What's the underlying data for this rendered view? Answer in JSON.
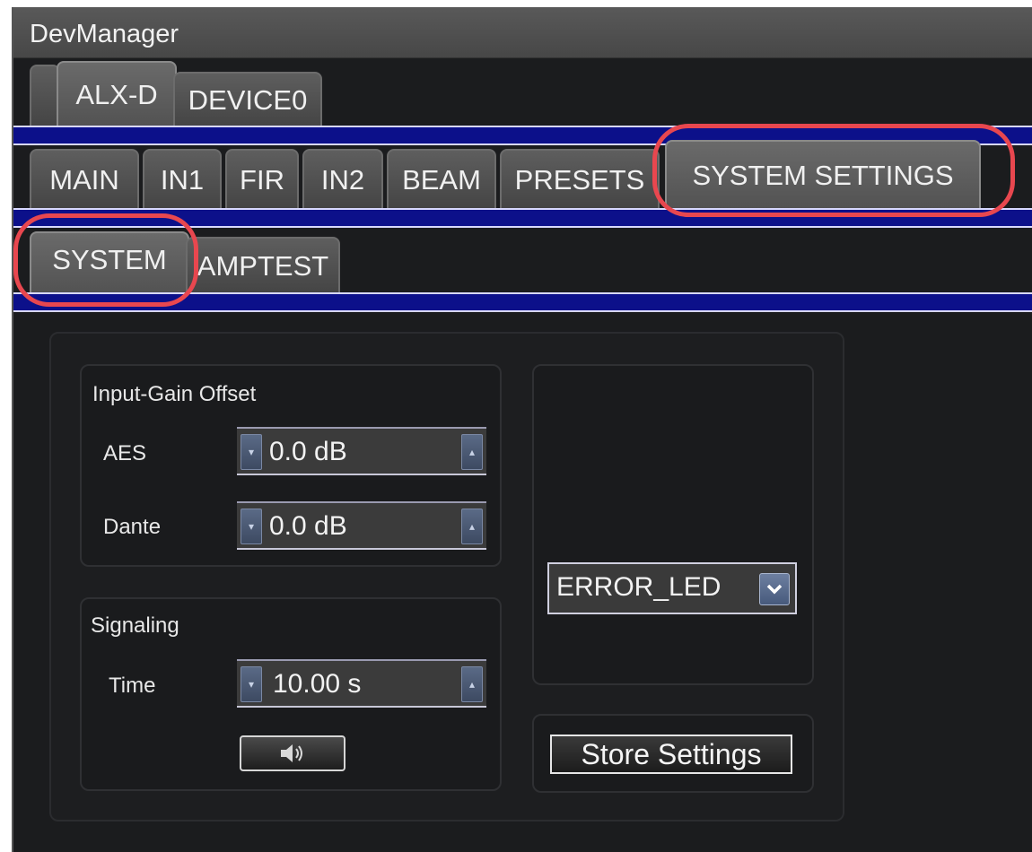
{
  "window": {
    "title": "DevManager"
  },
  "device_tabs": [
    {
      "label": ""
    },
    {
      "label": "ALX-D"
    },
    {
      "label": "DEVICE0"
    }
  ],
  "main_tabs": [
    {
      "label": "MAIN"
    },
    {
      "label": "IN1"
    },
    {
      "label": "FIR"
    },
    {
      "label": "IN2"
    },
    {
      "label": "BEAM"
    },
    {
      "label": "PRESETS"
    },
    {
      "label": "SYSTEM SETTINGS"
    }
  ],
  "sub_tabs": [
    {
      "label": "SYSTEM"
    },
    {
      "label": "AMPTEST"
    }
  ],
  "input_gain_offset": {
    "title": "Input-Gain Offset",
    "aes_label": "AES",
    "aes_value": "0.0 dB",
    "dante_label": "Dante",
    "dante_value": "0.0 dB"
  },
  "signaling": {
    "title": "Signaling",
    "time_label": "Time",
    "time_value": "10.00 s"
  },
  "led_select": {
    "selected": "ERROR_LED"
  },
  "store_button": {
    "label": "Store Settings"
  },
  "colors": {
    "accent_bar": "#0c108a",
    "highlight": "#e8474f",
    "background": "#1b1c1e"
  }
}
